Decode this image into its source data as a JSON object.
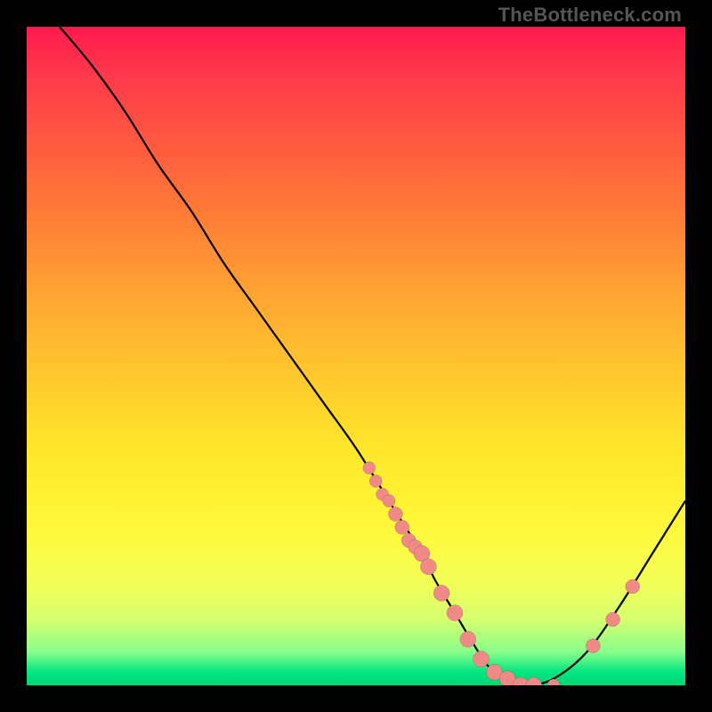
{
  "watermark": "TheBottleneck.com",
  "chart_data": {
    "type": "line",
    "title": "",
    "xlabel": "",
    "ylabel": "",
    "xlim": [
      0,
      100
    ],
    "ylim": [
      0,
      100
    ],
    "grid": false,
    "legend": false,
    "series": [
      {
        "name": "curve",
        "x": [
          5,
          10,
          15,
          20,
          25,
          30,
          35,
          40,
          45,
          50,
          55,
          60,
          62,
          65,
          68,
          70,
          73,
          76,
          80,
          85,
          90,
          95,
          100
        ],
        "y": [
          100,
          94,
          87,
          79,
          72,
          64,
          57,
          50,
          43,
          36,
          28,
          20,
          16,
          11,
          6,
          3,
          1,
          0,
          1,
          5,
          12,
          20,
          28
        ]
      }
    ],
    "markers": {
      "name": "points",
      "color": "#ef8a86",
      "x": [
        52,
        53,
        54,
        55,
        56,
        57,
        58,
        59,
        60,
        61,
        63,
        65,
        67,
        69,
        71,
        73,
        75,
        77,
        80,
        86,
        89,
        92
      ],
      "y": [
        33,
        31,
        29,
        28,
        26,
        24,
        22,
        21,
        20,
        18,
        14,
        11,
        7,
        4,
        2,
        1,
        0,
        0,
        0,
        6,
        10,
        15
      ],
      "r": [
        7,
        7,
        7,
        7,
        8,
        8,
        8,
        8,
        9,
        9,
        9,
        9,
        9,
        9,
        9,
        9,
        9,
        9,
        7,
        8,
        8,
        8
      ]
    }
  }
}
